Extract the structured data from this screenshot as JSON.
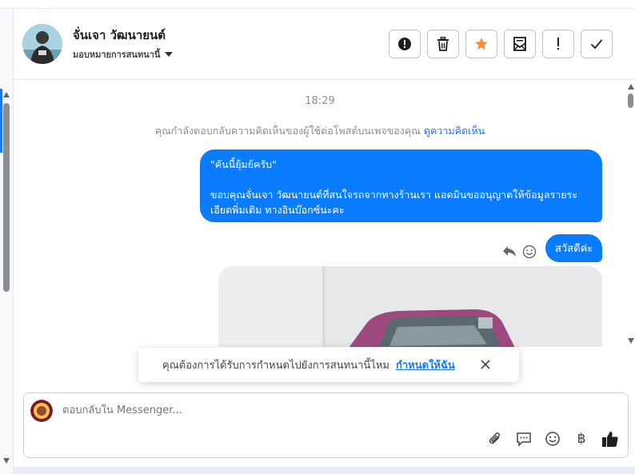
{
  "header": {
    "contact_name": "จั่นเจา วัฒนายนต์",
    "assign_label": "มอบหมายการสนทนานี้",
    "actions": [
      {
        "icon": "alert-circle-icon",
        "name": "mark-spam-button"
      },
      {
        "icon": "trash-icon",
        "name": "delete-button"
      },
      {
        "icon": "star-icon",
        "name": "star-button"
      },
      {
        "icon": "mark-unread-icon",
        "name": "mark-unread-button"
      },
      {
        "icon": "exclamation-icon",
        "name": "follow-up-button"
      },
      {
        "icon": "check-icon",
        "name": "mark-done-button"
      }
    ]
  },
  "chat": {
    "timestamp": "18:29",
    "notice_text": "คุณกำลังตอบกลับความคิดเห็นของผู้ใช้ต่อโพสต์บนเพจของคุณ",
    "notice_link": "ดูความคิดเห็น",
    "messages": [
      {
        "quote": "\"คันนี้ยุ้มย้ครับ\"",
        "text": "ขอบคุณจั่นเจา วัฒนายนต์ที่สนใจรถจากทางร้านเรา แอดมินขออนุญาตให้ข้อมูลรายระเอียดพิ่มเติม ทางอินบ๊อกซ์นะคะ"
      },
      {
        "text": "สวัสดีค่ะ"
      }
    ]
  },
  "toast": {
    "text": "คุณต้องการได้รับการกำหนดไปยังการสนทนานี้ไหม",
    "link": "กำหนดให้ฉัน"
  },
  "composer": {
    "placeholder": "ตอบกลับใน Messenger...",
    "baht_symbol": "฿"
  },
  "colors": {
    "accent": "#0a7cff",
    "link": "#1877f2",
    "star": "#f7923a"
  }
}
